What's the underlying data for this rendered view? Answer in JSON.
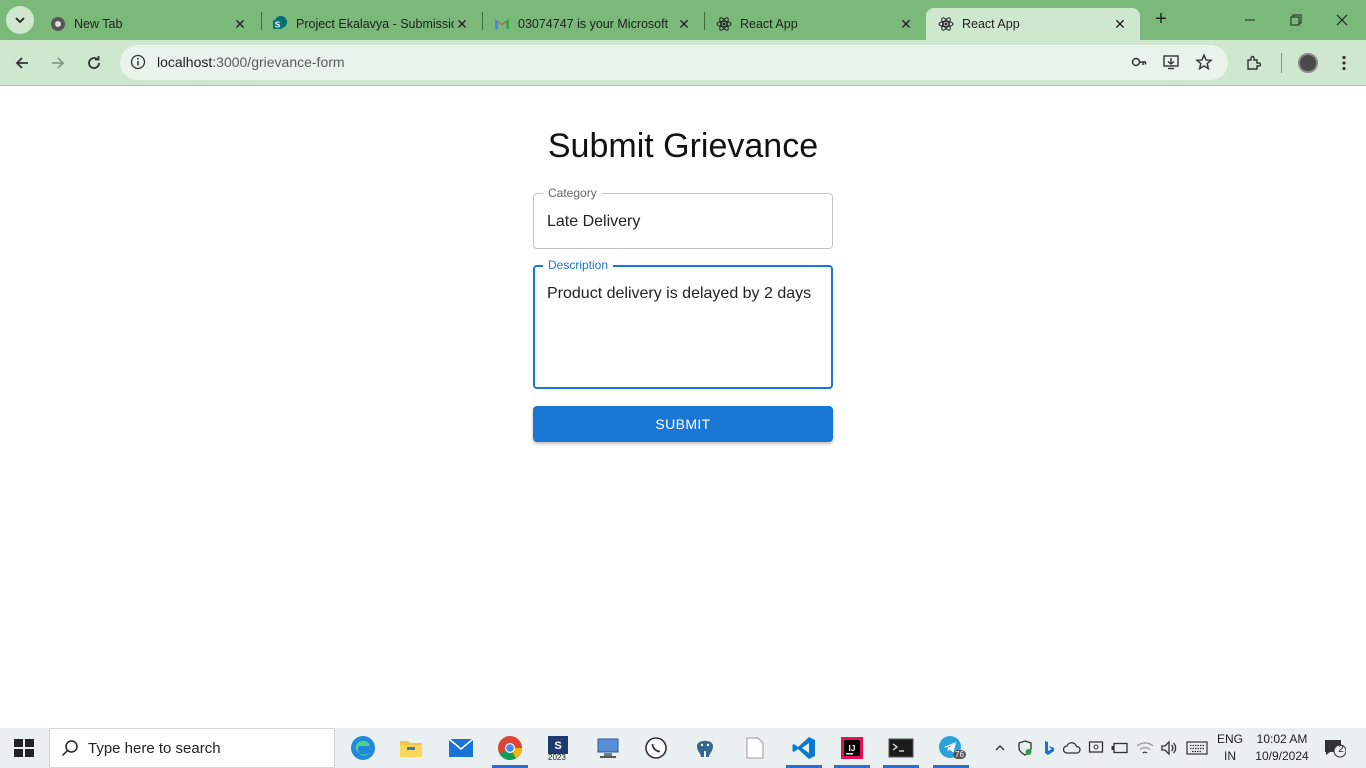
{
  "browser": {
    "tabs": [
      {
        "title": "New Tab",
        "favicon": "chrome-icon"
      },
      {
        "title": "Project Ekalavya - Submissio",
        "favicon": "sharepoint-icon"
      },
      {
        "title": "03074747 is your Microsoft",
        "favicon": "gmail-icon"
      },
      {
        "title": "React App",
        "favicon": "react-icon"
      },
      {
        "title": "React App",
        "favicon": "react-icon",
        "active": true
      }
    ],
    "url_host": "localhost",
    "url_path": ":3000/grievance-form",
    "accent_color": "#7ab97a"
  },
  "page": {
    "title": "Submit Grievance",
    "category_label": "Category",
    "category_value": "Late Delivery",
    "description_label": "Description",
    "description_value": "Product delivery is delayed by 2 days",
    "submit_label": "SUBMIT",
    "primary_color": "#1976d2"
  },
  "taskbar": {
    "search_placeholder": "Type here to search",
    "app_badge_2023": "2023",
    "telegram_badge": "76",
    "language": "ENG",
    "region": "IN",
    "time": "10:02 AM",
    "date": "10/9/2024",
    "notification_count": "2"
  }
}
